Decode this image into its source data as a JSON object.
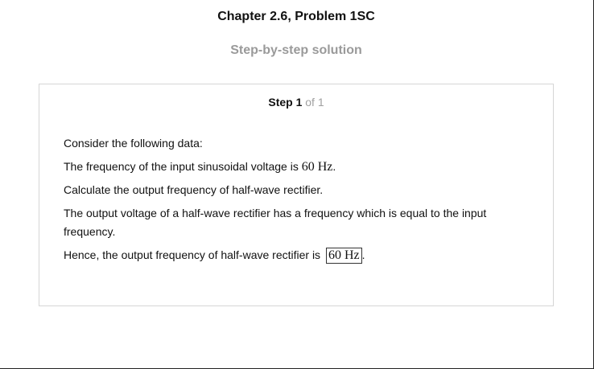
{
  "header": {
    "chapter_title": "Chapter 2.6, Problem 1SC",
    "subtitle": "Step-by-step solution"
  },
  "step": {
    "label": "Step 1",
    "of_text": "of 1",
    "paragraphs": {
      "p1": "Consider the following data:",
      "p2_text": "The frequency of the input sinusoidal voltage is",
      "p2_math": "60 Hz",
      "p2_end": ".",
      "p3": "Calculate the output frequency of half-wave rectifier.",
      "p4": "The output voltage of a half-wave rectifier has a frequency which is equal to the input frequency.",
      "p5_text": "Hence, the output frequency of half-wave rectifier is",
      "p5_answer": "60 Hz",
      "p5_end": "."
    }
  }
}
